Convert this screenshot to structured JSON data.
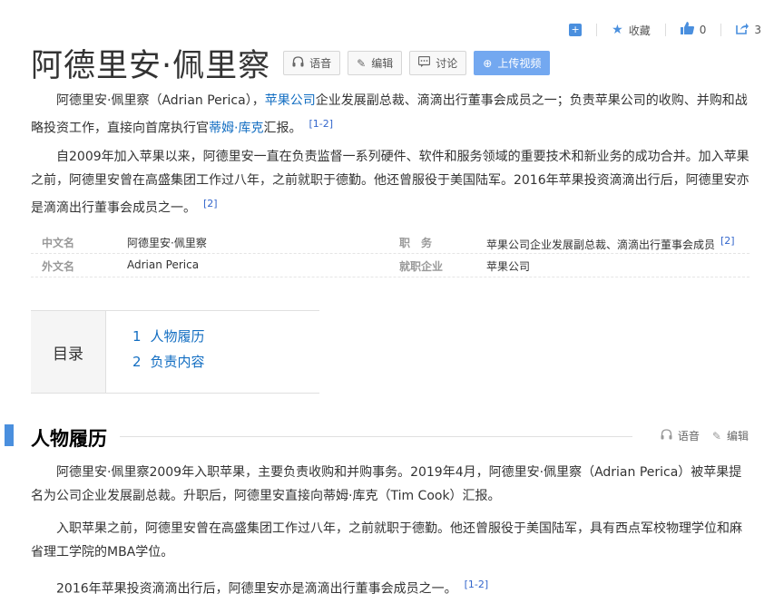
{
  "toolbar": {
    "plus_icon": "plus-square-icon",
    "star_icon": "star-icon",
    "collect_label": "收藏",
    "like_icon": "thumbs-up-icon",
    "like_count": "0",
    "share_icon": "share-icon",
    "share_count": "3"
  },
  "title": "阿德里安·佩里察",
  "title_buttons": [
    {
      "icon": "headphones-icon",
      "label": "语音"
    },
    {
      "icon": "pencil-icon",
      "label": "编辑"
    },
    {
      "icon": "comment-icon",
      "label": "讨论"
    },
    {
      "icon": "plus-circle-icon",
      "label": "上传视频"
    }
  ],
  "intro": {
    "p1_a": "阿德里安·佩里察（Adrian Perica），",
    "p1_link": "苹果公司",
    "p1_b": "企业发展副总裁、滴滴出行董事会成员之一；负责苹果公司的收购、并购和战略投资工作，直接向首席执行官",
    "p1_link2": "蒂姆·库克",
    "p1_c": "汇报。",
    "p1_ref": "[1-2]",
    "p2": "自2009年加入苹果以来，阿德里安一直在负责监督一系列硬件、软件和服务领域的重要技术和新业务的成功合并。加入苹果之前，阿德里安曾在高盛集团工作过八年，之前就职于德勤。他还曾服役于美国陆军。2016年苹果投资滴滴出行后，阿德里安亦是滴滴出行董事会成员之一。",
    "p2_ref": "[2]"
  },
  "infobox": {
    "cn_name_label": "中文名",
    "cn_name_value": "阿德里安·佩里察",
    "position_label": "职　务",
    "position_value": "苹果公司企业发展副总裁、滴滴出行董事会成员",
    "position_ref": "[2]",
    "en_name_label": "外文名",
    "en_name_value": "Adrian Perica",
    "company_label": "就职企业",
    "company_value": "苹果公司"
  },
  "toc": {
    "label": "目录",
    "items": [
      {
        "num": "1",
        "label": "人物履历"
      },
      {
        "num": "2",
        "label": "负责内容"
      }
    ]
  },
  "section": {
    "title": "人物履历",
    "voice_label": "语音",
    "edit_label": "编辑",
    "p1": "阿德里安·佩里察2009年入职苹果，主要负责收购和并购事务。2019年4月，阿德里安·佩里察（Adrian Perica）被苹果提名为公司企业发展副总裁。升职后，阿德里安直接向蒂姆·库克（Tim Cook）汇报。",
    "p2": "入职苹果之前，阿德里安曾在高盛集团工作过八年，之前就职于德勤。他还曾服役于美国陆军，具有西点军校物理学位和麻省理工学院的MBA学位。",
    "p3": "2016年苹果投资滴滴出行后，阿德里安亦是滴滴出行董事会成员之一。",
    "p3_ref": "[1-2]"
  },
  "colors": {
    "accent": "#4a8fde",
    "link": "#136ec2",
    "upload_button": "#73a8f0"
  }
}
